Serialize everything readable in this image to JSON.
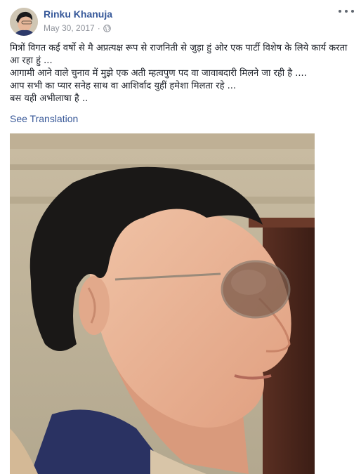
{
  "post": {
    "author": "Rinku Khanuja",
    "date": "May 30, 2017",
    "separator": "·",
    "privacy_icon": "globe-icon",
    "menu_icon": "more-options-icon",
    "lines": [
      "मित्रों विगत कई वर्षो से मै अप्रत्यक्ष रूप से राजनिती से जुड़ा हुं ओर एक पार्टी विशेष के लिये कार्य करता आ रहा हुं ...",
      "आगामी आने वाले चुनाव में मुझे एक अती म्हत्वपुण पद वा जावाबदारी मिलने जा रही है ....",
      "आप सभी का प्यार सनेह साथ वा आशिर्वाद युहीं हमेशा मिलता रहे ...",
      "बस यही अभीलाषा है .."
    ],
    "see_translation": "See Translation"
  },
  "colors": {
    "author_link": "#365899",
    "meta_gray": "#90949c",
    "text": "#1d2129",
    "link_blue": "#385898"
  }
}
